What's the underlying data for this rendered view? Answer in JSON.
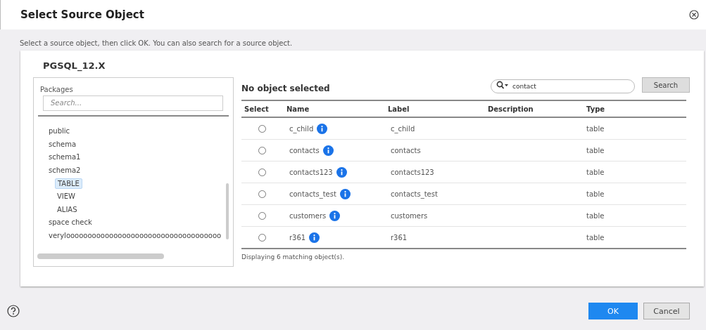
{
  "dialog": {
    "title": "Select Source Object",
    "instruction": "Select a source object, then click OK. You can also search for a source object."
  },
  "connection": "PGSQL_12.X",
  "packages": {
    "label": "Packages",
    "search_placeholder": "Search...",
    "tree": [
      {
        "label": "public",
        "selected": false
      },
      {
        "label": "schema",
        "selected": false
      },
      {
        "label": "schema1",
        "selected": false
      },
      {
        "label": "schema2",
        "selected": false,
        "children": [
          {
            "label": "TABLE",
            "selected": true
          },
          {
            "label": "VIEW",
            "selected": false
          },
          {
            "label": "ALIAS",
            "selected": false
          }
        ]
      },
      {
        "label": "space check",
        "selected": false
      },
      {
        "label": "veryloooooooooooooooooooooooooooooooooooo",
        "selected": false
      }
    ]
  },
  "objects": {
    "heading": "No object selected",
    "search_value": "contact",
    "search_button": "Search",
    "columns": [
      "Select",
      "Name",
      "Label",
      "Description",
      "Type"
    ],
    "rows": [
      {
        "selected": false,
        "name": "c_child",
        "label": "c_child",
        "type": "table"
      },
      {
        "selected": false,
        "name": "contacts",
        "label": "contacts",
        "type": "table"
      },
      {
        "selected": false,
        "name": "contacts123",
        "label": "contacts123",
        "type": "table"
      },
      {
        "selected": false,
        "name": "contacts_test",
        "label": "contacts_test",
        "type": "table"
      },
      {
        "selected": false,
        "name": "customers",
        "label": "customers",
        "type": "table"
      },
      {
        "selected": false,
        "name": "r361",
        "label": "r361",
        "type": "table"
      }
    ],
    "footer": "Displaying 6 matching object(s)."
  },
  "buttons": {
    "ok": "OK",
    "cancel": "Cancel"
  }
}
